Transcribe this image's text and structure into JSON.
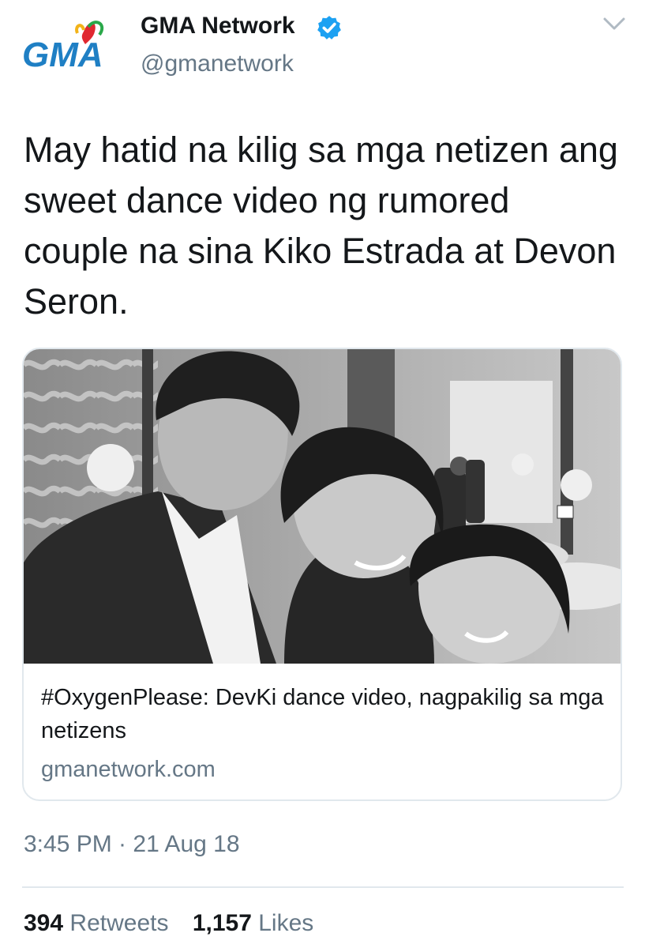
{
  "tweet": {
    "author": {
      "display_name": "GMA Network",
      "handle": "@gmanetwork",
      "verified": true,
      "logo_text": "GMA"
    },
    "text": "May hatid na kilig sa mga netizen ang sweet dance video ng rumored couple na sina Kiko Estrada at Devon Seron.",
    "card": {
      "title": "#OxygenPlease: DevKi dance video, nagpakilig sa mga netizens",
      "domain": "gmanetwork.com",
      "image_icon": "photo-grayscale"
    },
    "timestamp": "3:45 PM · 21 Aug 18",
    "stats": {
      "retweets_count": "394",
      "retweets_label": "Retweets",
      "likes_count": "1,157",
      "likes_label": "Likes"
    }
  },
  "colors": {
    "text_primary": "#14171a",
    "text_secondary": "#657786",
    "verified_blue": "#1da1f2",
    "border": "#e1e8ed",
    "logo_blue": "#1f7fc4",
    "logo_red": "#e02830"
  }
}
